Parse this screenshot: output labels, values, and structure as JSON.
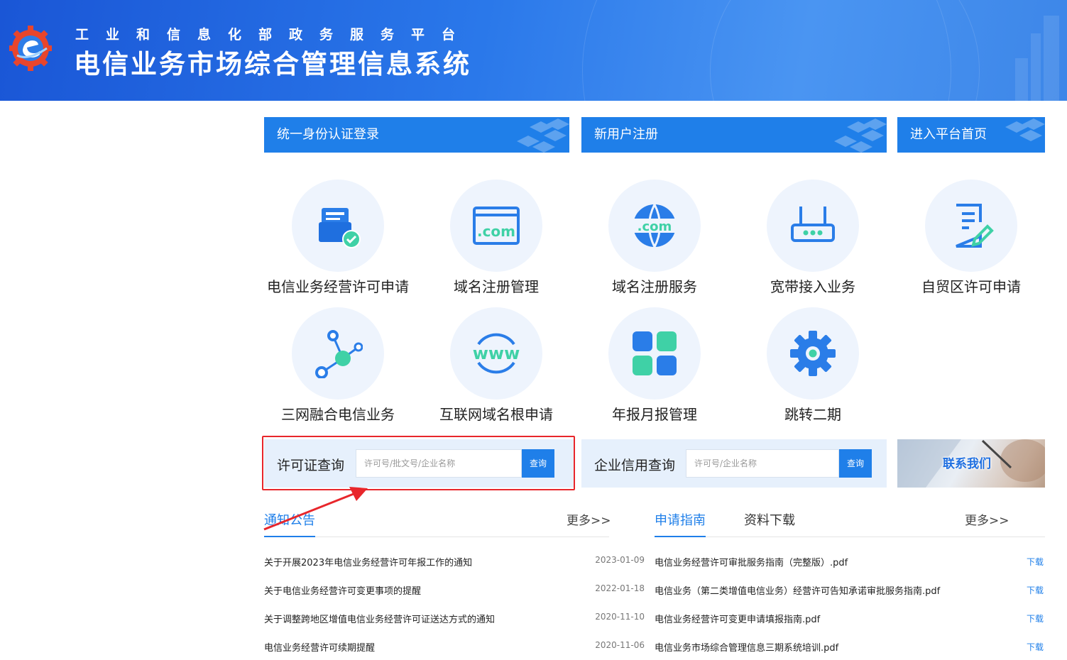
{
  "header": {
    "org_title": "工业和信息化部政务服务平台",
    "system_title": "电信业务市场综合管理信息系统",
    "logo_icon": "ministry-gear-logo-icon"
  },
  "top_buttons": [
    {
      "label": "统一身份认证登录"
    },
    {
      "label": "新用户注册"
    },
    {
      "label": "进入平台首页"
    }
  ],
  "services": [
    {
      "label": "电信业务经营许可申请",
      "icon": "license-approved-icon"
    },
    {
      "label": "域名注册管理",
      "icon": "dotcom-window-icon"
    },
    {
      "label": "域名注册服务",
      "icon": "dotcom-globe-icon"
    },
    {
      "label": "宽带接入业务",
      "icon": "router-icon"
    },
    {
      "label": "自贸区许可申请",
      "icon": "document-edit-icon"
    },
    {
      "label": "三网融合电信业务",
      "icon": "network-nodes-icon"
    },
    {
      "label": "互联网域名根申请",
      "icon": "www-icon"
    },
    {
      "label": "年报月报管理",
      "icon": "grid-blocks-icon"
    },
    {
      "label": "跳转二期",
      "icon": "gear-icon"
    }
  ],
  "license_query": {
    "label": "许可证查询",
    "placeholder": "许可号/批文号/企业名称",
    "button": "查询"
  },
  "credit_query": {
    "label": "企业信用查询",
    "placeholder": "许可号/企业名称",
    "button": "查询"
  },
  "contact": {
    "label": "联系我们"
  },
  "notices": {
    "tab": "通知公告",
    "more": "更多>>",
    "items": [
      {
        "title": "关于开展2023年电信业务经营许可年报工作的通知",
        "date": "2023-01-09"
      },
      {
        "title": "关于电信业务经营许可变更事项的提醒",
        "date": "2022-01-18"
      },
      {
        "title": "关于调整跨地区增值电信业务经营许可证送达方式的通知",
        "date": "2020-11-10"
      },
      {
        "title": "电信业务经营许可续期提醒",
        "date": "2020-11-06"
      }
    ]
  },
  "guides": {
    "tab_active": "申请指南",
    "tab_inactive": "资料下载",
    "more": "更多>>",
    "download_label": "下载",
    "items": [
      {
        "title": "电信业务经营许可审批服务指南（完整版）.pdf"
      },
      {
        "title": "电信业务（第二类增值电信业务）经营许可告知承诺审批服务指南.pdf"
      },
      {
        "title": "电信业务经营许可变更申请填报指南.pdf"
      },
      {
        "title": "电信业务市场综合管理信息三期系统培训.pdf"
      }
    ]
  },
  "colors": {
    "primary": "#1f7fe9",
    "teal": "#3fd1a6",
    "highlight": "#e8262b",
    "tile_bg": "#eef4fd"
  }
}
